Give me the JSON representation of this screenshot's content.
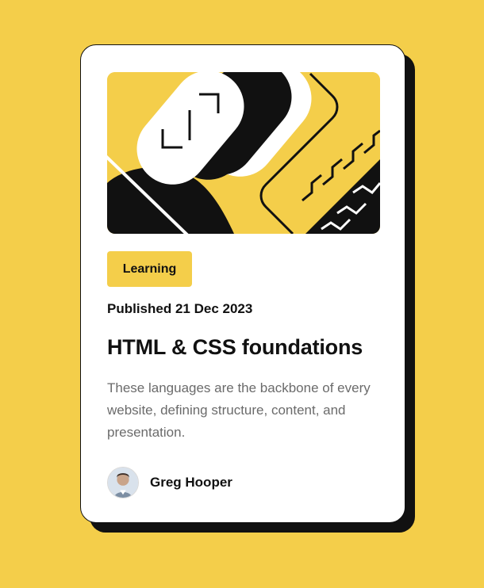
{
  "card": {
    "tag_label": "Learning",
    "published": "Published 21 Dec 2023",
    "title": "HTML & CSS foundations",
    "description": "These languages are the backbone of every website, defining structure, content, and presentation.",
    "author_name": "Greg Hooper",
    "hero_image_icon": "abstract-illustration-icon",
    "avatar_icon": "avatar-icon"
  },
  "colors": {
    "background": "#F4CE4A",
    "card": "#FFFFFF",
    "text": "#111111",
    "muted_text": "#6B6B6B",
    "shadow": "#111111"
  }
}
